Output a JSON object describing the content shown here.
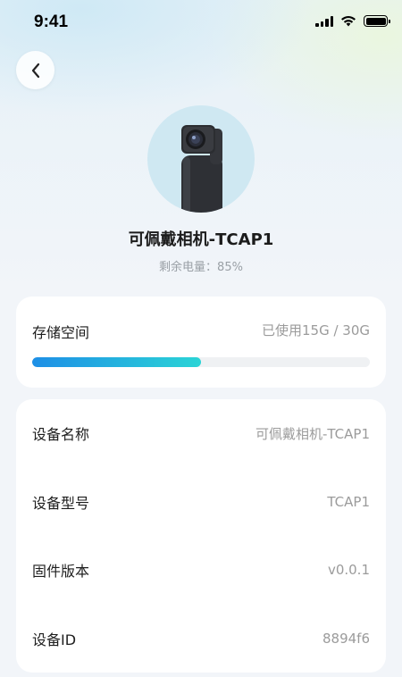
{
  "status_bar": {
    "time": "9:41",
    "signal_icon": "cellular-signal-icon",
    "wifi_icon": "wifi-icon",
    "battery_icon": "battery-icon"
  },
  "header": {
    "back_icon": "chevron-left-icon"
  },
  "device": {
    "name": "可佩戴相机-TCAP1",
    "battery_text": "剩余电量：85%",
    "image": "wearable-camera-photo"
  },
  "storage": {
    "label": "存储空间",
    "usage_text": "已使用15G / 30G",
    "used_fraction": 0.5,
    "bar_colors": {
      "start": "#1e8fe6",
      "end": "#2bd4d6"
    }
  },
  "info": [
    {
      "label": "设备名称",
      "value": "可佩戴相机-TCAP1"
    },
    {
      "label": "设备型号",
      "value": "TCAP1"
    },
    {
      "label": "固件版本",
      "value": "v0.0.1"
    },
    {
      "label": "设备ID",
      "value": "8894f6"
    }
  ]
}
